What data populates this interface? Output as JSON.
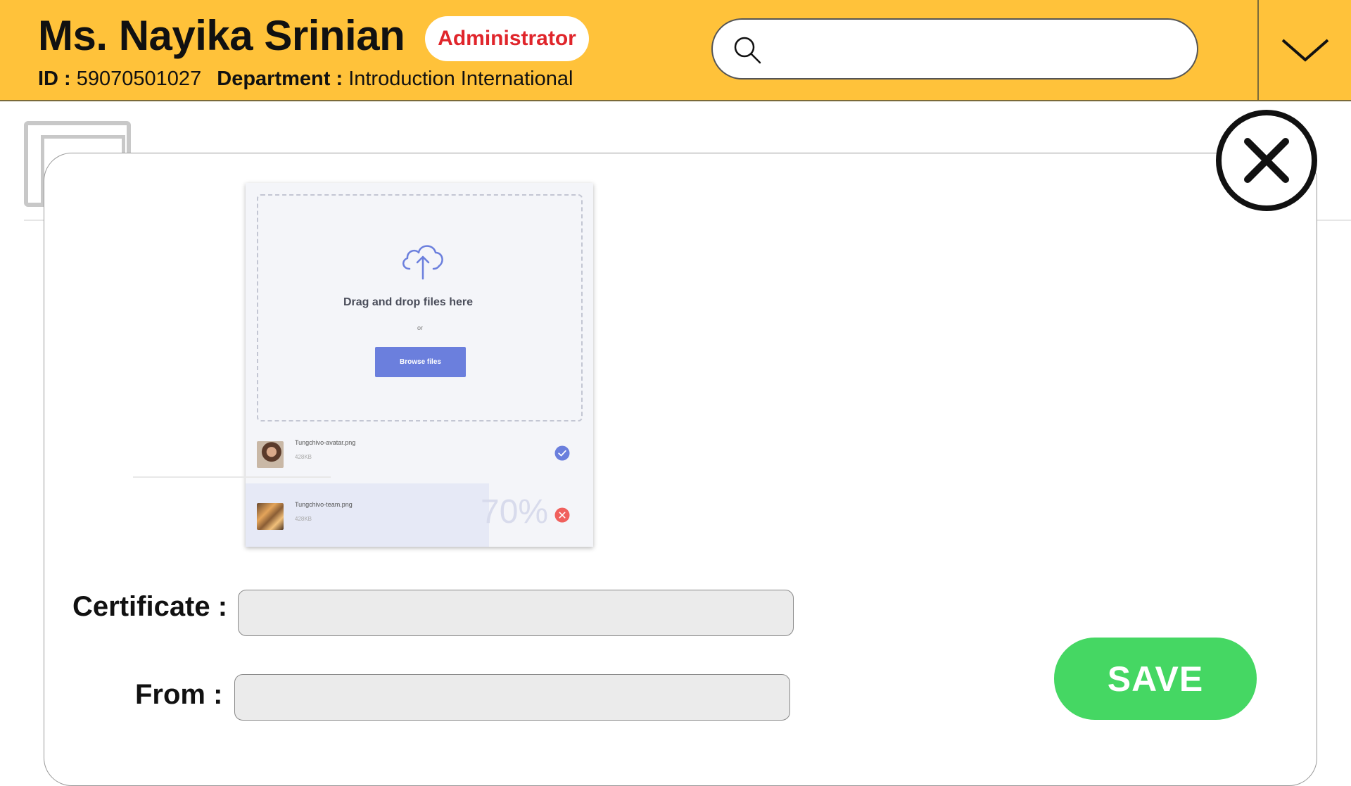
{
  "header": {
    "user_name": "Ms. Nayika Srinian",
    "role_badge": "Administrator",
    "id_label": "ID :",
    "id_value": "59070501027",
    "department_label": "Department :",
    "department_value": "Introduction International",
    "search_placeholder": "",
    "search_icon": "search-icon",
    "menu_icon": "chevron-down-icon"
  },
  "modal": {
    "close_icon": "close-icon",
    "uploader": {
      "drop_title": "Drag and drop files here",
      "or_text": "or",
      "browse_label": "Browse files",
      "files": [
        {
          "name": "Tungchivo-avatar.png",
          "size": "428KB",
          "status": "complete"
        },
        {
          "name": "Tungchivo-team.png",
          "size": "428KB",
          "status": "uploading",
          "progress_text": "70%",
          "progress": 0.7
        }
      ]
    },
    "form": {
      "certificate_label": "Certificate :",
      "certificate_value": "",
      "from_label": "From :",
      "from_value": "",
      "save_label": "SAVE"
    }
  },
  "colors": {
    "header_bg": "#FFC23A",
    "badge_text": "#E0252B",
    "save_bg": "#45D763",
    "browse_bg": "#6B7FDD",
    "check": "#6B7FDD",
    "cancel": "#F0605D"
  }
}
